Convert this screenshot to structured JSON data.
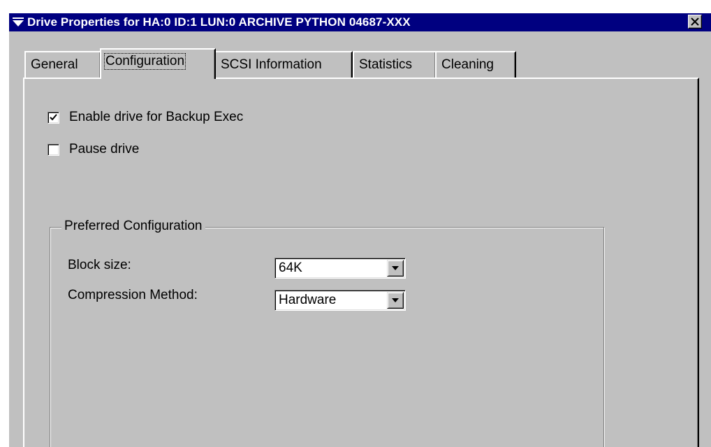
{
  "window": {
    "title": "Drive Properties for HA:0 ID:1 LUN:0 ARCHIVE PYTHON 04687-XXX",
    "title_icon": "dropdown-arrow-icon",
    "close_icon": "close-icon"
  },
  "tabs": [
    {
      "label": "General",
      "selected": false
    },
    {
      "label": "Configuration",
      "selected": true
    },
    {
      "label": "SCSI Information",
      "selected": false
    },
    {
      "label": "Statistics",
      "selected": false
    },
    {
      "label": "Cleaning",
      "selected": false
    }
  ],
  "options": {
    "enable_drive": {
      "label": "Enable drive for Backup Exec",
      "checked": true
    },
    "pause_drive": {
      "label": "Pause drive",
      "checked": false
    }
  },
  "preferred_configuration": {
    "title": "Preferred Configuration",
    "block_size": {
      "label": "Block size:",
      "value": "64K"
    },
    "compression_method": {
      "label": "Compression Method:",
      "value": "Hardware"
    }
  },
  "colors": {
    "titlebar": "#000080",
    "face": "#c0c0c0",
    "highlight": "#ffffff",
    "shadow": "#808080",
    "dark_shadow": "#000000"
  }
}
